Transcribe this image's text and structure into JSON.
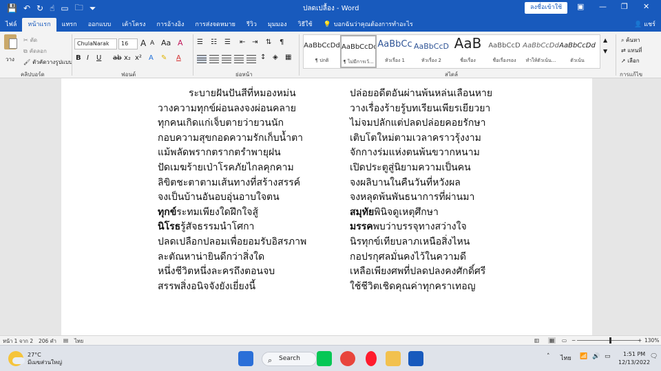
{
  "titlebar": {
    "doc_title": "ปลดเปลื้อง - Word",
    "signin_label": "ลงชื่อเข้าใช้",
    "qat_icons": [
      "save-icon",
      "undo-icon",
      "redo-icon",
      "touch-mode-icon",
      "open-icon",
      "folder-icon",
      "customize-icon"
    ]
  },
  "tabs": {
    "items": [
      "ไฟล์",
      "หน้าแรก",
      "แทรก",
      "ออกแบบ",
      "เค้าโครง",
      "การอ้างอิง",
      "การส่งจดหมาย",
      "รีวิว",
      "มุมมอง",
      "วิธีใช้"
    ],
    "active_index": 1,
    "tellme": "บอกฉันว่าคุณต้องการทำอะไร",
    "share": "แชร์"
  },
  "ribbon": {
    "clipboard": {
      "paste_label": "วาง",
      "cut": "ตัด",
      "copy": "คัดลอก",
      "format_painter": "ตัวคัดวางรูปแบบ",
      "group_label": "คลิปบอร์ด"
    },
    "font": {
      "font_name": "ChulaNarak",
      "font_size": "16",
      "group_label": "ฟอนต์"
    },
    "paragraph": {
      "group_label": "ย่อหน้า"
    },
    "styles": {
      "group_label": "สไตล์",
      "items": [
        {
          "sample": "AaBbCcDd",
          "name": "¶ ปกติ"
        },
        {
          "sample": "AaBbCcDd",
          "name": "¶ ไม่มีการเว้...",
          "selected": true
        },
        {
          "sample": "AaBbCc",
          "name": "หัวเรื่อง 1"
        },
        {
          "sample": "AaBbCcD",
          "name": "หัวเรื่อง 2"
        },
        {
          "sample": "AaB",
          "name": "ชื่อเรื่อง"
        },
        {
          "sample": "AaBbCcD",
          "name": "ชื่อเรื่องรอง"
        },
        {
          "sample": "AaBbCcDd",
          "name": "ทำให้ตัวเน้น..."
        },
        {
          "sample": "AaBbCcDd",
          "name": "ตัวเน้น"
        }
      ]
    },
    "editing": {
      "find": "ค้นหา",
      "replace": "แทนที่",
      "select": "เลือก",
      "group_label": "การแก้ไข"
    }
  },
  "document": {
    "left_column": [
      "ระบายฝันปันสีที่หมองหม่น",
      "วางความทุกข์ผ่อนลงจงผ่อนคลาย",
      "ทุกคนเกิดแก่เจ็บตายว่ายวนนัก",
      "กอบความสุขกอดความรักเก็บน้ำตา",
      "แม้พลัดพรากตรากตรำพายุฝน",
      "ปัดเมฆร้ายเป่าโรคภัยไกลคุกคาม",
      "ลิขิตชะตาตามเส้นทางที่สร้างสรรค์",
      "จงเป็นบ้านอันอบอุ่นอาบใจตน",
      "ระทมเพียงใดฝึกใจสู้",
      "รู้สัจธรรมนำโศกา",
      "ปลดเปลือกปลอมเพื่อยอมรับอิสรภาพ",
      "ละตัณหาน่ายินดีกว่าสิ่งใด",
      "หนึ่งชีวิตหนึ่งละครถึงตอนจบ",
      "สรรพสิ่งอนิจจังยังเยี่ยงนี้"
    ],
    "left_bold": {
      "8": "ทุกข์",
      "9": "นิโรธ"
    },
    "right_column": [
      "ปล่อยอดีตอันผ่านพ้นหล่นเลือนหาย",
      "วางเรื่องร้ายรู้บทเรียนเพียรเยียวยา",
      "ไม่จมปลักแต่ปลดปล่อยคอยรักษา",
      "เติบโตใหม่ตามเวลาคราวรุ้งงาม",
      "จักกางร่มแห่งตนพ้นขวากหนาม",
      "เปิดประตูสู่นิยามความเป็นคน",
      "จงผลิบานในคืนวันที่หวังผล",
      "จงหลุดพ้นพันธนาการที่ผ่านมา",
      "พินิจดูเหตุศึกษา",
      "พบว่าบรรจุทางสว่างใจ",
      "นิรทุกข์เทียบลาภเหนือสิ่งไหน",
      "กอปรกุศลมั่นคงไว้ในความดี",
      "เหลือเพียงศพที่ปลดปลงคงศักดิ์ศรี",
      "ใช้ชีวิตเชิดคุณค่าทุกคราเทอญ"
    ],
    "right_bold": {
      "8": "สมุทัย",
      "9": "มรรค"
    }
  },
  "statusbar": {
    "page": "หน้า 1 จาก 2",
    "words": "206 คำ",
    "language": "ไทย",
    "zoom": "130%",
    "zoom_level": 1.3
  },
  "taskbar": {
    "temperature": "27°C",
    "weather": "มีเมฆส่วนใหญ่",
    "search_label": "Search",
    "lang": "ไทย",
    "time": "1:51 PM",
    "date": "12/13/2022"
  },
  "colors": {
    "word_blue": "#185abd",
    "ribbon_bg": "#f3f3f3",
    "doc_bg": "#e6e6e6"
  }
}
